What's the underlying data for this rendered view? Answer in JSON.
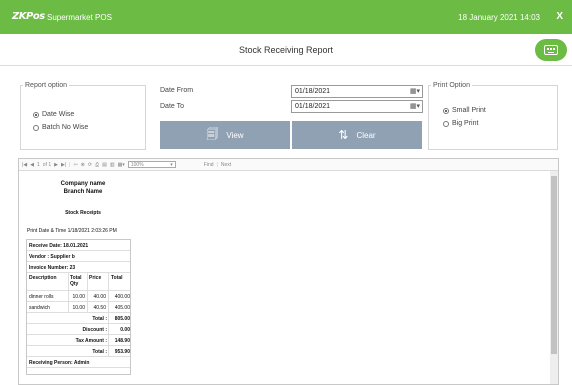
{
  "titlebar": {
    "logo": "ZKPos",
    "app_name": "Supermarket POS",
    "datetime": "18 January 2021 14:03",
    "close": "X"
  },
  "header": {
    "title": "Stock Receiving Report",
    "keyboard_icon": "keyboard-icon"
  },
  "report_option": {
    "legend": "Report option",
    "options": [
      {
        "label": "Date Wise",
        "selected": true
      },
      {
        "label": "Batch No Wise",
        "selected": false
      }
    ]
  },
  "dates": {
    "from_label": "Date From",
    "from_value": "01/18/2021",
    "to_label": "Date To",
    "to_value": "01/18/2021",
    "calendar_icon": "calendar-icon"
  },
  "buttons": {
    "view": "View",
    "view_icon": "report-view-icon",
    "clear": "Clear",
    "clear_icon": "refresh-icon",
    "color": "#8fa1b3"
  },
  "print_option": {
    "legend": "Print Option",
    "options": [
      {
        "label": "Small Print",
        "selected": true
      },
      {
        "label": "Big Print",
        "selected": false
      }
    ]
  },
  "toolbar": {
    "page": "1",
    "of_pages": "of 1",
    "zoom": "100%",
    "find": "Find",
    "next": "Next"
  },
  "report": {
    "company_name": "Company name",
    "branch_name": "Branch Name",
    "title": "Stock Receipts",
    "print_datetime": "Print Date & Time  1/18/2021 2:03:26 PM",
    "receive_date": "Receive Date: 18.01.2021",
    "vendor": "Vendor   : Supplier b",
    "invoice": "Invoice Number: 23",
    "columns": {
      "description": "Description",
      "total_qty": "Total Qty",
      "price": "Price",
      "total": "Total"
    },
    "items": [
      {
        "description": "dinner rolls",
        "qty": "10.00",
        "price": "40.00",
        "total": "400.00"
      },
      {
        "description": "sandwich",
        "qty": "10.00",
        "price": "40.50",
        "total": "405.00"
      }
    ],
    "totals": {
      "total_label": "Total :",
      "total_value": "805.00",
      "discount_label": "Discount :",
      "discount_value": "0.00",
      "tax_label": "Tax Amount :",
      "tax_value": "148.90",
      "grand_label": "Total :",
      "grand_value": "953.90"
    },
    "receiving_person": "Receiving Person: Admin"
  },
  "colors": {
    "brand": "#6cbb45",
    "button": "#8fa1b3"
  }
}
